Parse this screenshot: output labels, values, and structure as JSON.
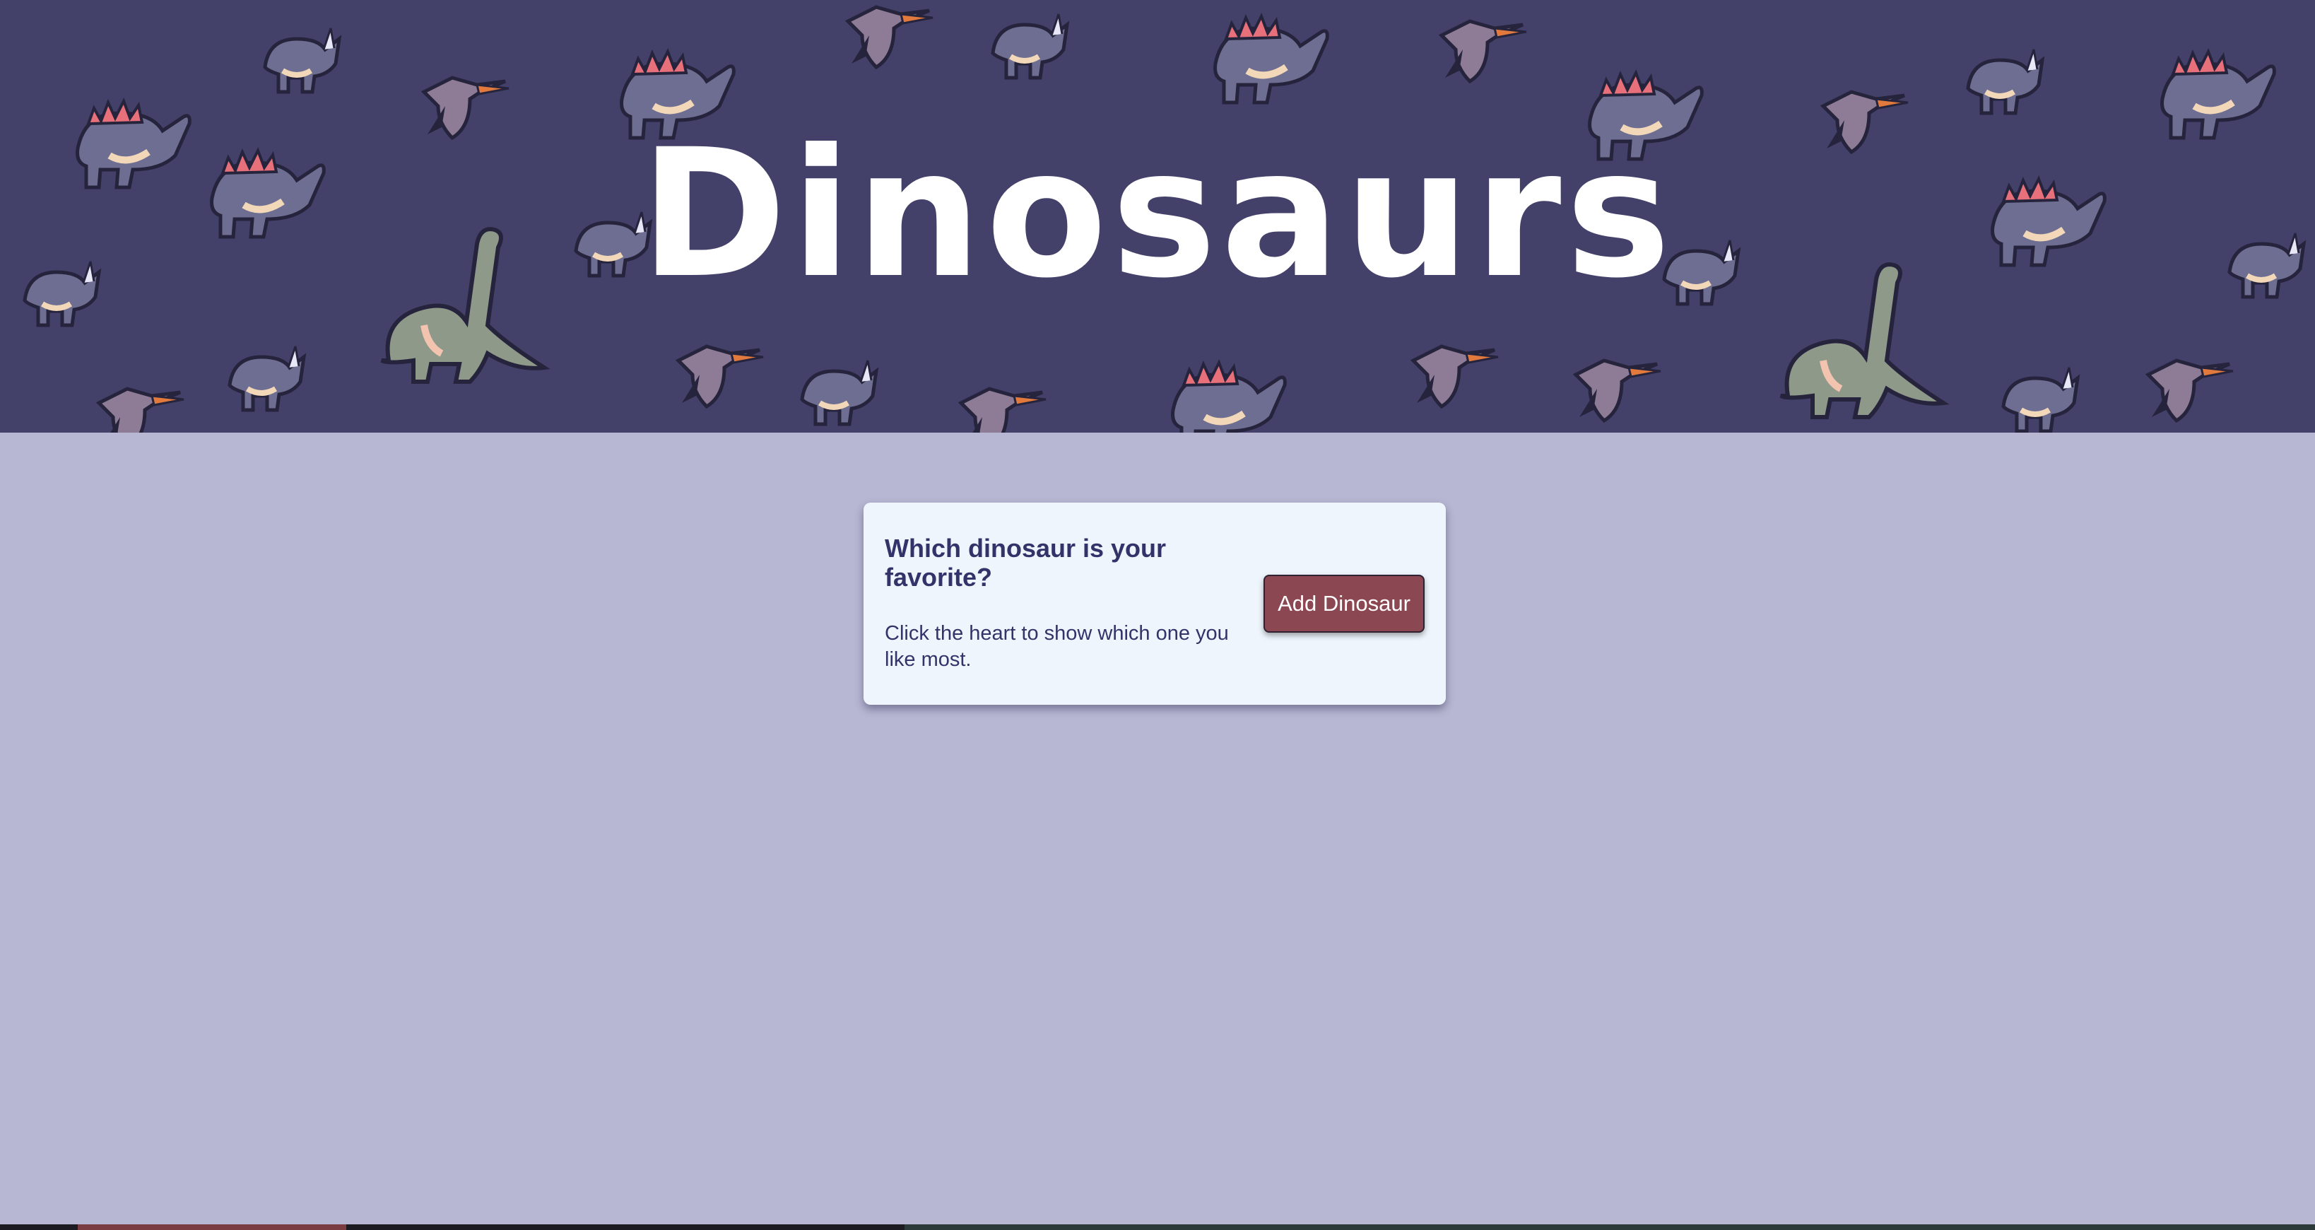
{
  "hero": {
    "title": "Dinosaurs"
  },
  "card": {
    "title": "Which dinosaur is your favorite?",
    "description": "Click the heart to show which one you like most.",
    "button_label": "Add Dinosaur"
  },
  "colors": {
    "hero_background": "#43416a",
    "page_background": "#b7b7d4",
    "card_background": "#eef5fc",
    "accent_text": "#35326a",
    "button_background": "#8b4752"
  }
}
